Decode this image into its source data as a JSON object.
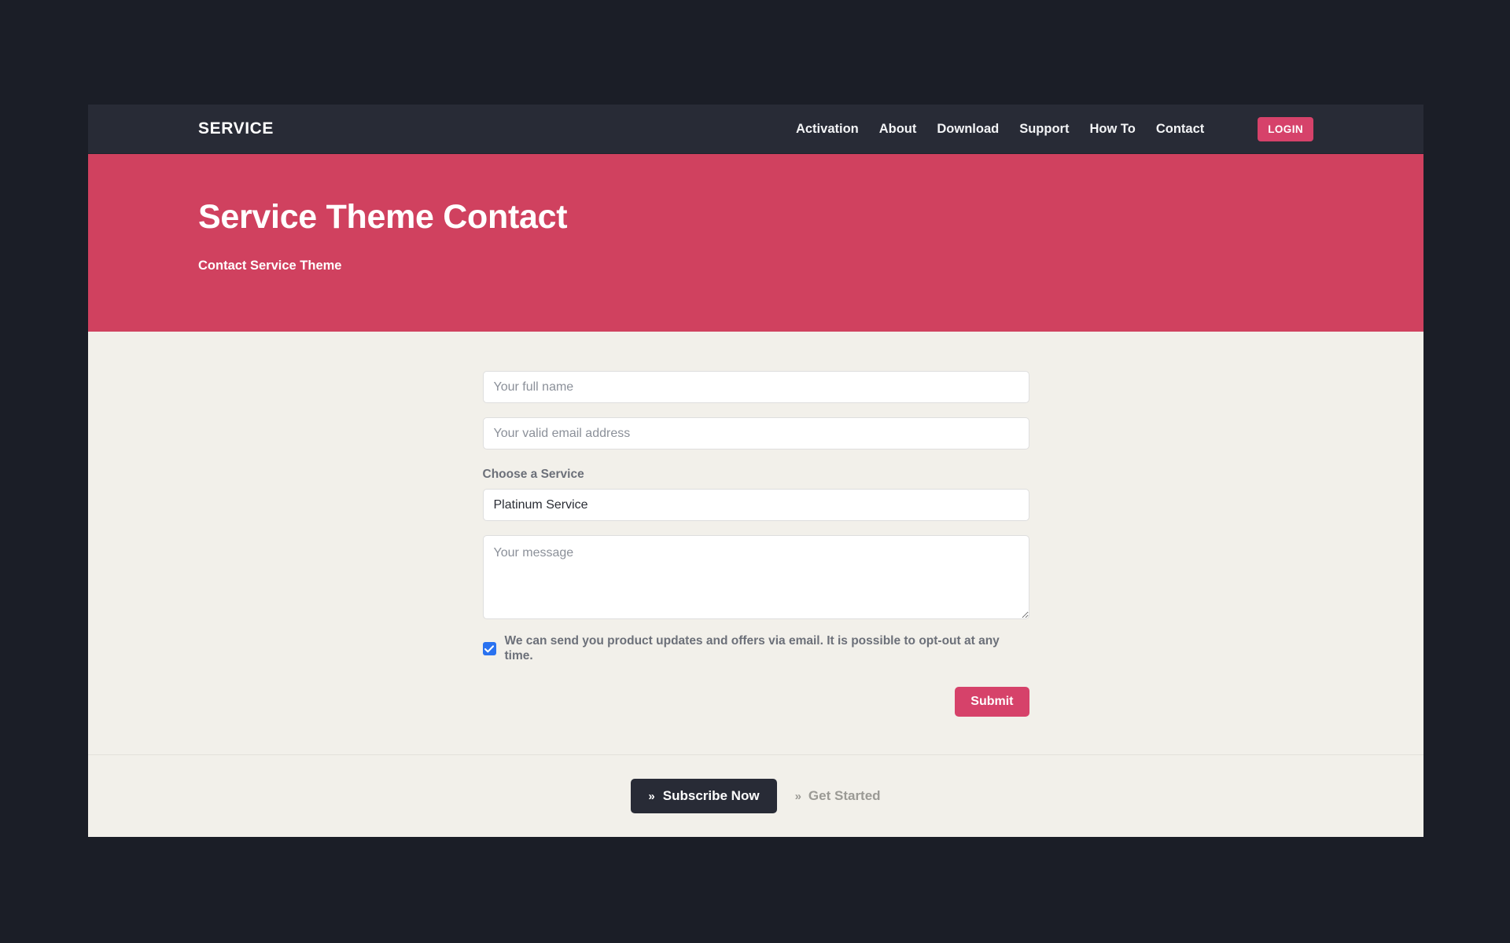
{
  "header": {
    "brand": "SERVICE",
    "nav": [
      {
        "label": "Activation"
      },
      {
        "label": "About"
      },
      {
        "label": "Download"
      },
      {
        "label": "Support"
      },
      {
        "label": "How To"
      },
      {
        "label": "Contact"
      }
    ],
    "login_label": "LOGIN"
  },
  "hero": {
    "title": "Service Theme Contact",
    "subtitle": "Contact Service Theme"
  },
  "form": {
    "name_placeholder": "Your full name",
    "name_value": "",
    "email_placeholder": "Your valid email address",
    "email_value": "",
    "service_label": "Choose a Service",
    "service_selected": "Platinum Service",
    "service_options": [
      "Platinum Service"
    ],
    "message_placeholder": "Your message",
    "message_value": "",
    "consent_text": "We can send you product updates and offers via email. It is possible to opt-out at any time.",
    "consent_checked": "checked",
    "submit_label": "Submit"
  },
  "footer": {
    "subscribe_label": "Subscribe Now",
    "subscribe_icon": "double-chevron-right-icon",
    "getstarted_label": "Get Started",
    "getstarted_icon": "double-chevron-right-icon",
    "chevron_glyph": "»"
  },
  "colors": {
    "accent_pink": "#d0415f",
    "button_pink": "#d6426a",
    "header_dark": "#282b36",
    "page_background": "#1b1e27",
    "content_cream": "#f2f0ea",
    "checkbox_blue": "#2a72f0"
  }
}
